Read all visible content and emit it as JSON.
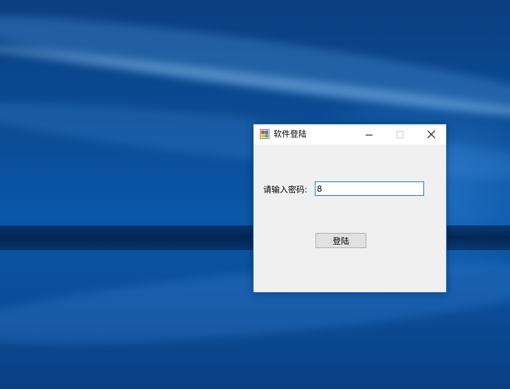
{
  "window": {
    "title": "软件登陆",
    "accent_color": "#0078d7"
  },
  "titlebar": {
    "minimize_icon": "minimize-icon",
    "maximize_icon": "maximize-icon",
    "close_icon": "close-icon"
  },
  "form": {
    "password_label": "请输入密码:",
    "password_value": "8",
    "login_label": "登陆"
  }
}
